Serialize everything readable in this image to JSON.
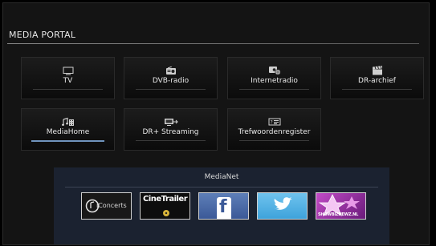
{
  "portal": {
    "title": "MEDIA PORTAL"
  },
  "tiles": [
    {
      "label": "TV",
      "icon": "tv-icon",
      "active": false
    },
    {
      "label": "DVB-radio",
      "icon": "radio-icon",
      "active": false
    },
    {
      "label": "Internetradio",
      "icon": "internet-radio-icon",
      "active": false
    },
    {
      "label": "DR-archief",
      "icon": "clapperboard-icon",
      "active": false
    },
    {
      "label": "MediaHome",
      "icon": "music-film-icon",
      "active": true
    },
    {
      "label": "DR+ Streaming",
      "icon": "streaming-icon",
      "active": false
    },
    {
      "label": "Trefwoordenregister",
      "icon": "index-icon",
      "active": false
    }
  ],
  "medianet": {
    "title": "MediaNet",
    "services": [
      {
        "name": "iConcerts",
        "logo_text": "iConcerts"
      },
      {
        "name": "CineTrailer",
        "logo_text": "CineTrailer"
      },
      {
        "name": "Facebook",
        "logo_text": "f"
      },
      {
        "name": "Twitter",
        "logo_text": ""
      },
      {
        "name": "Showbiznewz",
        "logo_text": "SHOWBIZNEWZ.NL"
      }
    ]
  },
  "colors": {
    "background": "#000000",
    "panel": "#141414",
    "medianet_panel": "#1b2230",
    "active_underline": "#6f93bd",
    "text": "#e8e8e8"
  }
}
